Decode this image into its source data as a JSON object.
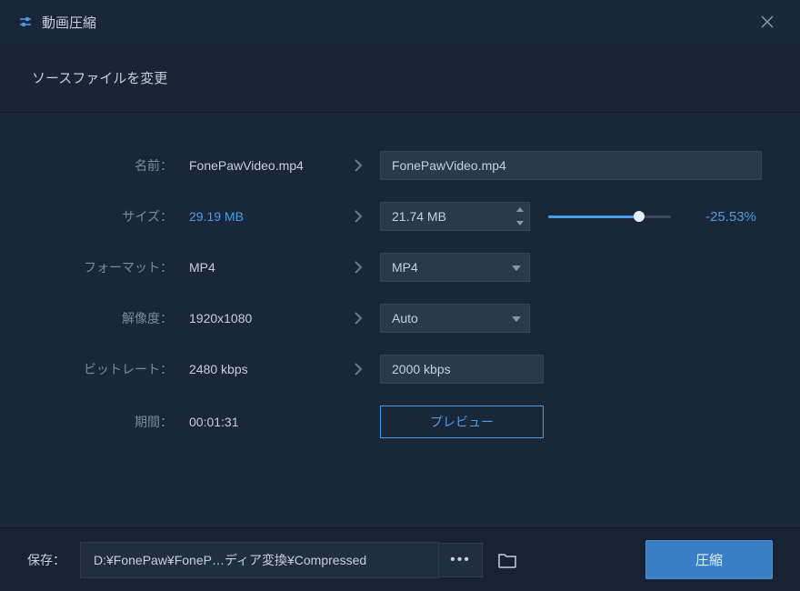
{
  "window": {
    "title": "動画圧縮"
  },
  "subheader": {
    "text": "ソースファイルを変更"
  },
  "labels": {
    "name": "名前：",
    "size": "サイズ：",
    "format": "フォーマット：",
    "resolution": "解像度：",
    "bitrate": "ビットレート：",
    "duration": "期間："
  },
  "source": {
    "name": "FonePawVideo.mp4",
    "size": "29.19 MB",
    "format": "MP4",
    "resolution": "1920x1080",
    "bitrate": "2480 kbps",
    "duration": "00:01:31"
  },
  "target": {
    "name": "FonePawVideo.mp4",
    "size": "21.74 MB",
    "format": "MP4",
    "resolution": "Auto",
    "bitrate": "2000 kbps",
    "size_reduction_pct": "-25.53%"
  },
  "buttons": {
    "preview": "プレビュー",
    "compress": "圧縮"
  },
  "footer": {
    "save_label": "保存：",
    "save_path": "D:¥FonePaw¥FoneP…ディア変換¥Compressed",
    "menu_dots": "•••"
  }
}
